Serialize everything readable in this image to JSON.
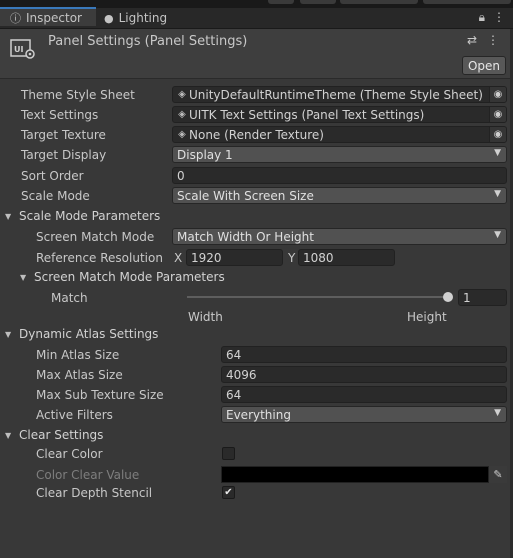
{
  "tabs": [
    {
      "label": "Inspector",
      "icon": "info-icon"
    },
    {
      "label": "Lighting",
      "icon": "lightbulb-icon"
    }
  ],
  "tab_icons": [
    "lock-icon",
    "menu-icon"
  ],
  "component": {
    "title": "Panel Settings (Panel Settings)",
    "open_label": "Open",
    "icon": "ui-toolkit-settings-icon",
    "header_icons": [
      "settings-sliders-icon",
      "more-icon"
    ]
  },
  "fields": {
    "theme_style_sheet": {
      "label": "Theme Style Sheet",
      "value": "UnityDefaultRuntimeTheme (Theme Style Sheet)"
    },
    "text_settings": {
      "label": "Text Settings",
      "value": "UITK Text Settings (Panel Text Settings)"
    },
    "target_texture": {
      "label": "Target Texture",
      "value": "None (Render Texture)"
    },
    "target_display": {
      "label": "Target Display",
      "value": "Display 1"
    },
    "sort_order": {
      "label": "Sort Order",
      "value": "0"
    },
    "scale_mode": {
      "label": "Scale Mode",
      "value": "Scale With Screen Size"
    }
  },
  "scale_mode_parameters": {
    "header": "Scale Mode Parameters",
    "screen_match_mode": {
      "label": "Screen Match Mode",
      "value": "Match Width Or Height"
    },
    "reference_resolution": {
      "label": "Reference Resolution",
      "x_label": "X",
      "x": "1920",
      "y_label": "Y",
      "y": "1080"
    },
    "screen_match_mode_parameters": {
      "header": "Screen Match Mode Parameters",
      "match": {
        "label": "Match",
        "value": "1",
        "slider_fraction": 1.0,
        "left_label": "Width",
        "right_label": "Height"
      }
    }
  },
  "dynamic_atlas": {
    "header": "Dynamic Atlas Settings",
    "min_atlas_size": {
      "label": "Min Atlas Size",
      "value": "64"
    },
    "max_atlas_size": {
      "label": "Max Atlas Size",
      "value": "4096"
    },
    "max_sub_texture_size": {
      "label": "Max Sub Texture Size",
      "value": "64"
    },
    "active_filters": {
      "label": "Active Filters",
      "value": "Everything"
    }
  },
  "clear_settings": {
    "header": "Clear Settings",
    "clear_color": {
      "label": "Clear Color",
      "checked": false
    },
    "color_clear_value": {
      "label": "Color Clear Value",
      "color": "#000000"
    },
    "clear_depth_stencil": {
      "label": "Clear Depth Stencil",
      "checked": true,
      "mark": "✔"
    }
  },
  "colors": {
    "accent": "#3a79bb",
    "background": "#383838"
  }
}
